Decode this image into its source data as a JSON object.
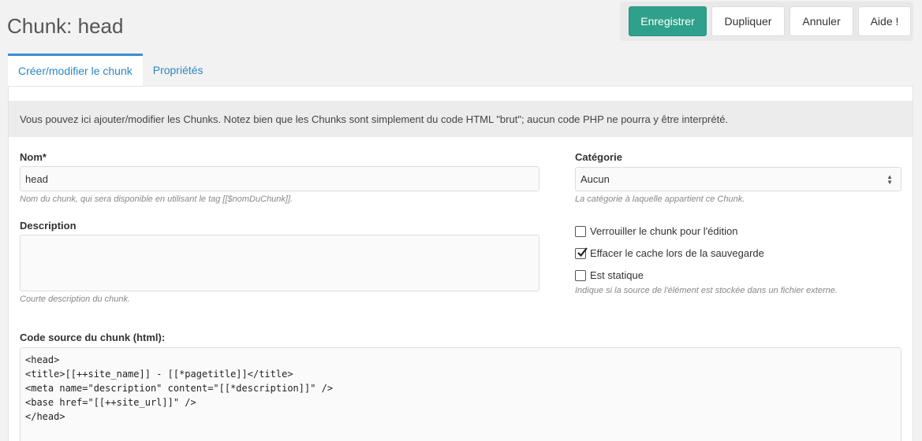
{
  "header": {
    "title": "Chunk: head"
  },
  "toolbar": {
    "save_label": "Enregistrer",
    "duplicate_label": "Dupliquer",
    "cancel_label": "Annuler",
    "help_label": "Aide !"
  },
  "tabs": [
    {
      "label": "Créer/modifier le chunk",
      "active": true
    },
    {
      "label": "Propriétés",
      "active": false
    }
  ],
  "notice": "Vous pouvez ici ajouter/modifier les Chunks. Notez bien que les Chunks sont simplement du code HTML \"brut\"; aucun code PHP ne pourra y être interprété.",
  "form": {
    "name": {
      "label": "Nom*",
      "value": "head",
      "hint": "Nom du chunk, qui sera disponible en utilisant le tag [[$nomDuChunk]]."
    },
    "description": {
      "label": "Description",
      "value": "",
      "hint": "Courte description du chunk."
    },
    "category": {
      "label": "Catégorie",
      "value": "Aucun",
      "hint": "La catégorie à laquelle appartient ce Chunk."
    },
    "checkboxes": [
      {
        "label": "Verrouiller le chunk pour l'édition",
        "checked": false
      },
      {
        "label": "Effacer le cache lors de la sauvegarde",
        "checked": true
      },
      {
        "label": "Est statique",
        "checked": false
      }
    ],
    "static_hint": "Indique si la source de l'élément est stockée dans un fichier externe.",
    "code": {
      "label": "Code source du chunk (html):",
      "value": "<head>\n<title>[[++site_name]] - [[*pagetitle]]</title>\n<meta name=\"description\" content=\"[[*description]]\" />\n<base href=\"[[++site_url]]\" />\n</head>"
    }
  },
  "colors": {
    "primary": "#2fa08b",
    "link": "#2e86c1",
    "tab_accent": "#3a8dd6"
  },
  "icons": {
    "select": "select-arrows-icon",
    "checked": "checkmark-icon"
  }
}
